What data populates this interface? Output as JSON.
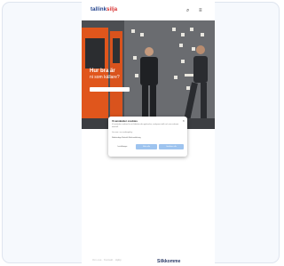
{
  "site": {
    "logo_main": "tallink",
    "logo_accent": "silja",
    "brand_color": "#1d3e8a",
    "accent_color": "#d62828"
  },
  "header": {
    "search_icon": "search-icon",
    "menu_icon": "hamburger-menu-icon",
    "search_glyph": "⌕",
    "menu_glyph": "≡"
  },
  "hero": {
    "title": "Hur bra är",
    "subtitle": "ni som källare?"
  },
  "cookie_modal": {
    "title": "Vi använder cookies",
    "close_glyph": "×",
    "body": "Vi använder cookies för att förbättra din upplevelse, analysera trafik och visa relevant innehåll.",
    "body_more": "Läs mer i vår cookiepolicy.",
    "toggles": "Nödvändiga  Statistik  Marknadsföring",
    "settings_label": "Inställningar",
    "reject_label": "Neka alla",
    "accept_label": "Godkänn alla",
    "button_color": "#9ec4ef"
  },
  "footer": {
    "links": "Om oss  ·  Kontakt  ·  Hjälp",
    "brand": "Silkkomme"
  }
}
